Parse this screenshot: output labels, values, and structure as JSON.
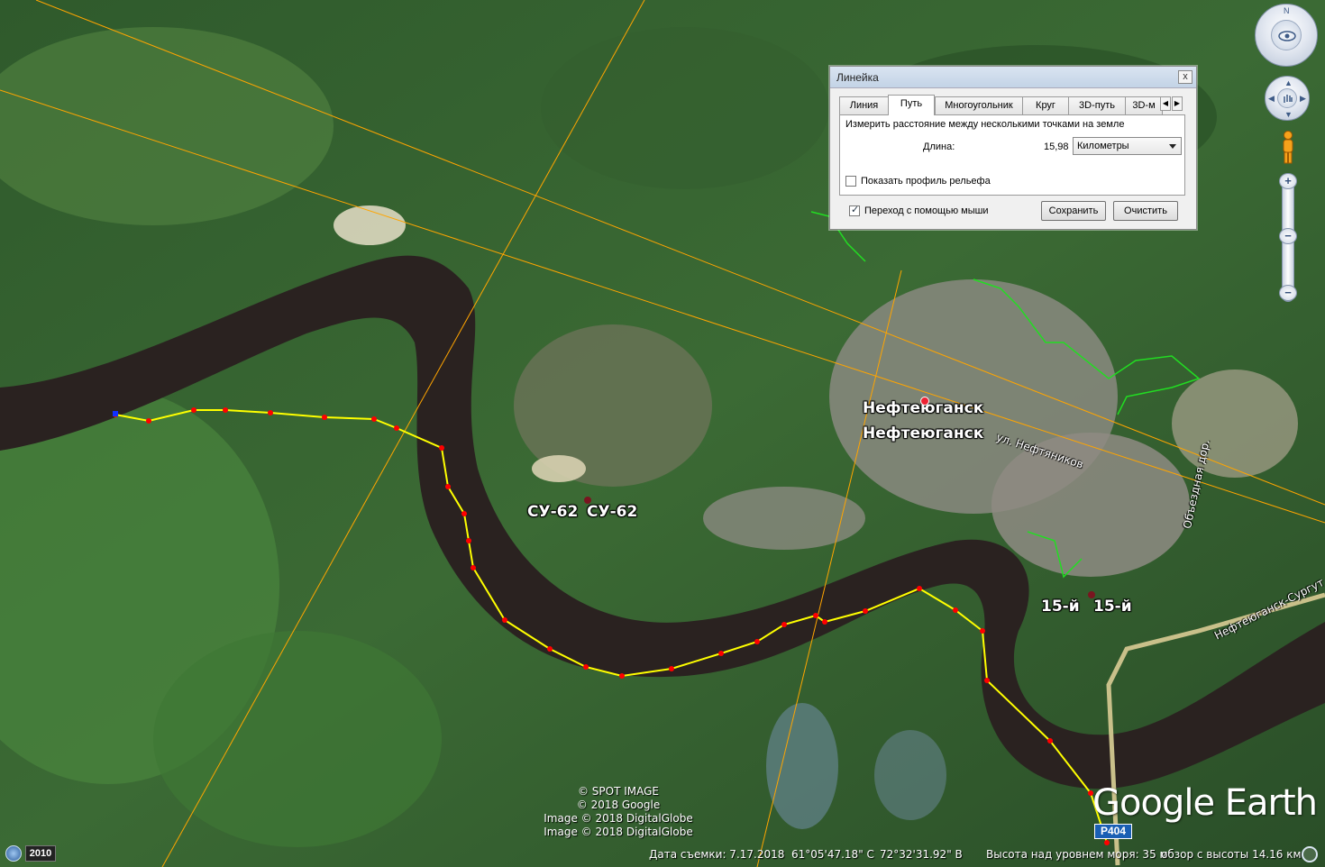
{
  "map": {
    "places": [
      {
        "name": "Нефтеюганск",
        "label": "Нефтеюганск"
      },
      {
        "name": "Нефтеюганск-2",
        "label": "Нефтеюганск"
      },
      {
        "name": "su62-a",
        "label": "СУ-62"
      },
      {
        "name": "su62-b",
        "label": "СУ-62"
      },
      {
        "name": "15-a",
        "label": "15-й"
      },
      {
        "name": "15-b",
        "label": "15-й"
      }
    ],
    "roads": {
      "street": "ул. Нефтяников",
      "bypass": "Объездная дор.",
      "highway": "Нефтеюганск-Сургут"
    },
    "road_shield": "Р404",
    "attribution": [
      "© SPOT IMAGE",
      "© 2018 Google",
      "Image © 2018 DigitalGlobe",
      "Image © 2018 DigitalGlobe"
    ],
    "logo": "Google Earth",
    "colors": {
      "path": "#ffff00",
      "vertex": "#ff0000",
      "gridline": "#ffa500",
      "boundary": "#22dd22",
      "river": "#2a2220"
    }
  },
  "ruler": {
    "title": "Линейка",
    "close": "x",
    "tabs": [
      "Линия",
      "Путь",
      "Многоугольник",
      "Круг",
      "3D-путь",
      "3D-м"
    ],
    "active_tab": "Путь",
    "description": "Измерить расстояние между несколькими точками на земле",
    "length_label": "Длина:",
    "length_value": "15,98",
    "unit": "Километры",
    "profile_label": "Показать профиль рельефа",
    "mouse_nav_label": "Переход с помощью мыши",
    "save_label": "Сохранить",
    "clear_label": "Очистить"
  },
  "status": {
    "year": "2010",
    "date": "Дата съемки: 7.17.2018",
    "lat": "61°05'47.18\" С",
    "lon": "72°32'31.92\" В",
    "elevation": "Высота над уровнем моря:   35 м",
    "eye_alt": "обзор с высоты  14.16 км"
  }
}
